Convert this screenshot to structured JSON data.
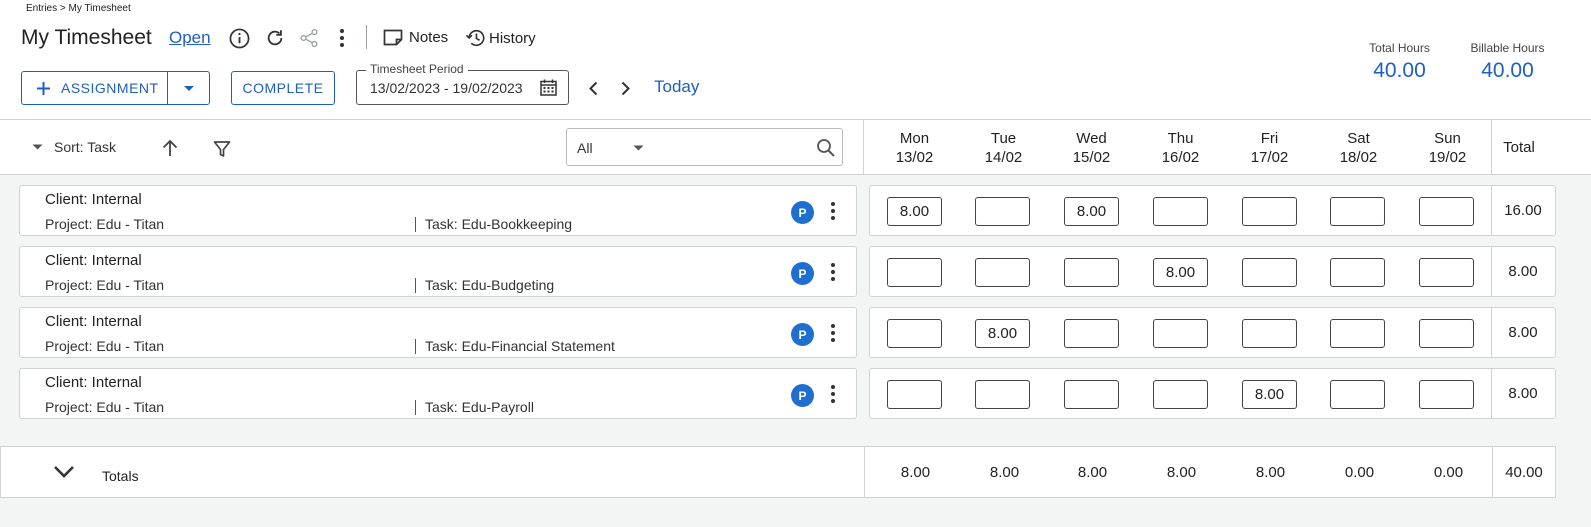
{
  "breadcrumb": "Entries > My Timesheet",
  "title": "My Timesheet",
  "status_link": "Open",
  "toolbar": {
    "notes_label": "Notes",
    "history_label": "History",
    "assignment_label": "ASSIGNMENT",
    "complete_label": "COMPLETE",
    "period_legend": "Timesheet Period",
    "period_value": "13/02/2023 - 19/02/2023",
    "today_label": "Today"
  },
  "summary": {
    "total_hours_label": "Total Hours",
    "total_hours_value": "40.00",
    "billable_hours_label": "Billable Hours",
    "billable_hours_value": "40.00"
  },
  "list": {
    "sort_label": "Sort: Task",
    "filter_value": "All",
    "total_header": "Total"
  },
  "days": [
    {
      "name": "Mon",
      "date": "13/02"
    },
    {
      "name": "Tue",
      "date": "14/02"
    },
    {
      "name": "Wed",
      "date": "15/02"
    },
    {
      "name": "Thu",
      "date": "16/02"
    },
    {
      "name": "Fri",
      "date": "17/02"
    },
    {
      "name": "Sat",
      "date": "18/02"
    },
    {
      "name": "Sun",
      "date": "19/02"
    }
  ],
  "rows": [
    {
      "client": "Client: Internal",
      "project": "Project: Edu - Titan",
      "task": "Task: Edu-Bookkeeping",
      "badge": "P",
      "hours": [
        "8.00",
        "",
        "8.00",
        "",
        "",
        "",
        ""
      ],
      "total": "16.00"
    },
    {
      "client": "Client: Internal",
      "project": "Project: Edu - Titan",
      "task": "Task: Edu-Budgeting",
      "badge": "P",
      "hours": [
        "",
        "",
        "",
        "8.00",
        "",
        "",
        ""
      ],
      "total": "8.00"
    },
    {
      "client": "Client: Internal",
      "project": "Project: Edu - Titan",
      "task": "Task: Edu-Financial Statement",
      "badge": "P",
      "hours": [
        "",
        "8.00",
        "",
        "",
        "",
        "",
        ""
      ],
      "total": "8.00"
    },
    {
      "client": "Client: Internal",
      "project": "Project: Edu - Titan",
      "task": "Task: Edu-Payroll",
      "badge": "P",
      "hours": [
        "",
        "",
        "",
        "",
        "8.00",
        "",
        ""
      ],
      "total": "8.00"
    }
  ],
  "totals": {
    "label": "Totals",
    "values": [
      "8.00",
      "8.00",
      "8.00",
      "8.00",
      "8.00",
      "0.00",
      "0.00"
    ],
    "grand_total": "40.00"
  },
  "colors": {
    "accent": "#1f5fbf",
    "badge": "#1f6fd1",
    "background": "#f3f4f4"
  }
}
